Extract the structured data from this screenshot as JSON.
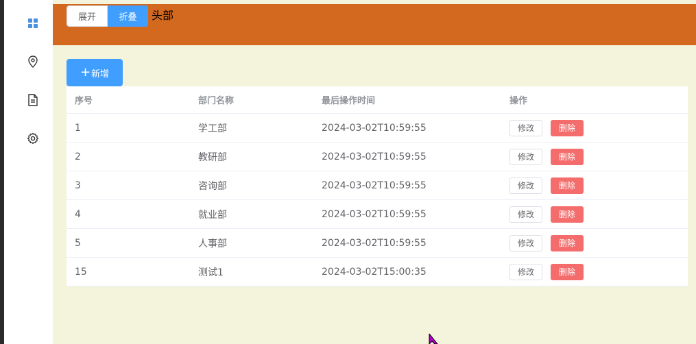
{
  "sidebar": {
    "items": [
      {
        "icon": "grid-icon"
      },
      {
        "icon": "location-pin-icon"
      },
      {
        "icon": "document-icon"
      },
      {
        "icon": "gear-icon"
      }
    ]
  },
  "header": {
    "expand_label": "展开",
    "fold_label": "折叠",
    "title": "头部"
  },
  "toolbar": {
    "add_label": "新增",
    "add_icon": "+"
  },
  "table": {
    "columns": [
      "序号",
      "部门名称",
      "最后操作时间",
      "操作"
    ],
    "edit_label": "修改",
    "delete_label": "删除",
    "rows": [
      {
        "id": "1",
        "name": "学工部",
        "updated": "2024-03-02T10:59:55"
      },
      {
        "id": "2",
        "name": "教研部",
        "updated": "2024-03-02T10:59:55"
      },
      {
        "id": "3",
        "name": "咨询部",
        "updated": "2024-03-02T10:59:55"
      },
      {
        "id": "4",
        "name": "就业部",
        "updated": "2024-03-02T10:59:55"
      },
      {
        "id": "5",
        "name": "人事部",
        "updated": "2024-03-02T10:59:55"
      },
      {
        "id": "15",
        "name": "测试1",
        "updated": "2024-03-02T15:00:35"
      }
    ]
  },
  "colors": {
    "header_bg": "#d2691e",
    "main_bg": "#f4f4dc",
    "primary": "#409eff",
    "danger": "#f56c6c",
    "sidebar_icon": "#4a8fe0"
  }
}
